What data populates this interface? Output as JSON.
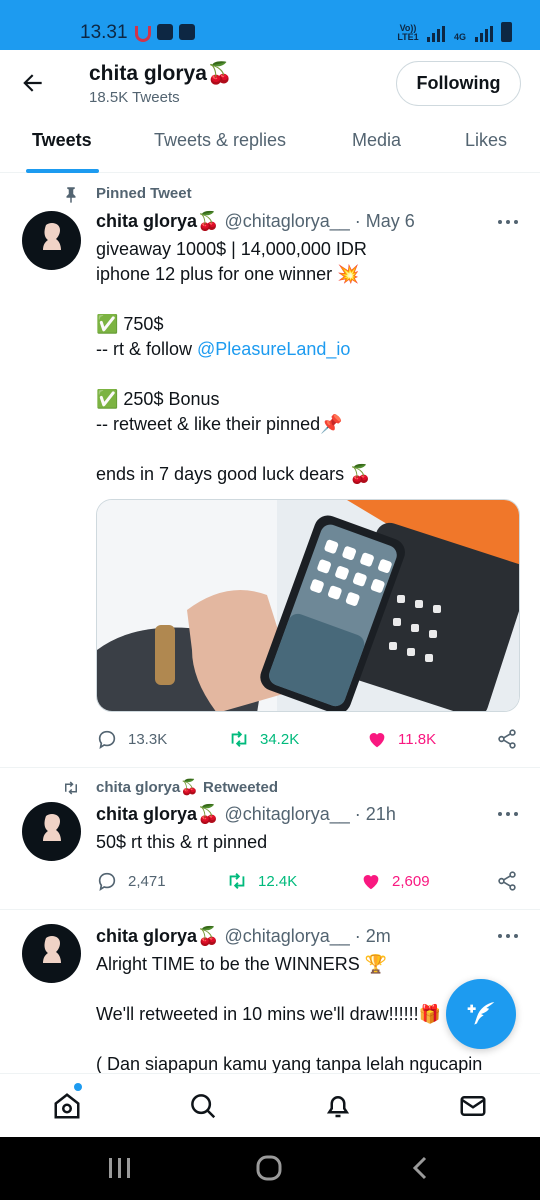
{
  "status_bar": {
    "time": "13.31",
    "net1": "Vo)) LTE1",
    "net2": "4G",
    "icons": [
      "magnet-icon",
      "gallery-icon",
      "app-icon",
      "signal-icon",
      "battery-icon"
    ]
  },
  "header": {
    "name": "chita glorya🍒",
    "tweet_count": "18.5K Tweets",
    "follow_label": "Following"
  },
  "tabs": [
    {
      "label": "Tweets",
      "active": true
    },
    {
      "label": "Tweets & replies",
      "active": false
    },
    {
      "label": "Media",
      "active": false
    },
    {
      "label": "Likes",
      "active": false
    }
  ],
  "tweets": [
    {
      "social_context": "Pinned Tweet",
      "display_name": "chita glorya🍒",
      "meta": " @chitaglorya__ · May 6",
      "lines": {
        "l1": "giveaway 1000$ | 14,000,000 IDR\niphone 12 plus for one winner 💥\n\n✅ 750$\n-- rt & follow ",
        "link": "@PleasureLand_io",
        "l2": "\n\n✅ 250$ Bonus\n-- retweet & like their pinned📌\n\nends in 7 days good luck dears 🍒"
      },
      "replies": "13.3K",
      "retweets": "34.2K",
      "likes": "11.8K"
    },
    {
      "social_context": "chita glorya🍒 Retweeted",
      "display_name": "chita glorya🍒",
      "meta": " @chitaglorya__ · 21h",
      "text": "50$ rt this & rt pinned",
      "replies": "2,471",
      "retweets": "12.4K",
      "likes": "2,609"
    },
    {
      "display_name": "chita glorya🍒",
      "meta": " @chitaglorya__ · 2m",
      "text": "Alright TIME to be the WINNERS 🏆\n\nWe'll retweeted in 10 mins we'll draw!!!!!!🎁\n\n( Dan siapapun kamu yang tanpa lelah ngucapin"
    }
  ],
  "colors": {
    "accent": "#1d9bf0",
    "retweet": "#00ba7c",
    "like": "#f91880",
    "secondary_text": "#536471"
  }
}
